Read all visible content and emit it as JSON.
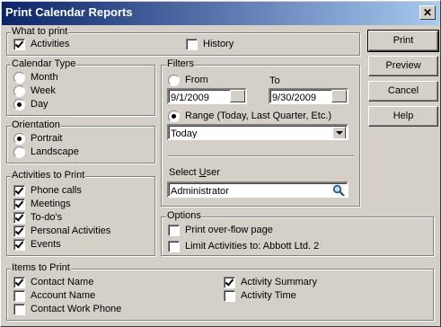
{
  "window": {
    "title": "Print Calendar Reports",
    "close_glyph": "✕"
  },
  "what_to_print": {
    "legend": "What to print",
    "activities": {
      "label": "Activities",
      "checked": true
    },
    "history": {
      "label": "History",
      "checked": false
    }
  },
  "calendar_type": {
    "legend": "Calendar Type",
    "options": [
      {
        "label": "Month",
        "selected": false
      },
      {
        "label": "Week",
        "selected": false
      },
      {
        "label": "Day",
        "selected": true
      }
    ]
  },
  "filters": {
    "legend": "Filters",
    "from_label": "From",
    "to_label": "To",
    "from_value": "9/1/2009",
    "to_value": "9/30/2009",
    "range_label": "Range (Today, Last Quarter, Etc.)",
    "range_value": "Today",
    "select_user_label_pre": "Select ",
    "select_user_label_ul": "U",
    "select_user_label_post": "ser",
    "user_value": "Administrator"
  },
  "orientation": {
    "legend": "Orientation",
    "options": [
      {
        "label": "Portrait",
        "selected": true
      },
      {
        "label": "Landscape",
        "selected": false
      }
    ]
  },
  "activities_to_print": {
    "legend": "Activities to Print",
    "items": [
      {
        "label": "Phone calls",
        "checked": true
      },
      {
        "label": "Meetings",
        "checked": true
      },
      {
        "label": "To-do's",
        "checked": true
      },
      {
        "label": "Personal Activities",
        "checked": true
      },
      {
        "label": "Events",
        "checked": true
      }
    ]
  },
  "options": {
    "legend": "Options",
    "items": [
      {
        "label": "Print over-flow page",
        "checked": false
      },
      {
        "label": "Limit Activities to: Abbott Ltd. 2",
        "checked": false
      }
    ]
  },
  "items_to_print": {
    "legend": "Items to Print",
    "items": [
      {
        "label": "Contact Name",
        "checked": true
      },
      {
        "label": "Account Name",
        "checked": false
      },
      {
        "label": "Contact Work Phone",
        "checked": false
      },
      {
        "label": "Activity Summary",
        "checked": true
      },
      {
        "label": "Activity Time",
        "checked": false
      }
    ]
  },
  "buttons": {
    "print": "Print",
    "preview": "Preview",
    "cancel": "Cancel",
    "help": "Help"
  },
  "icons": {
    "search": "magnifier-icon",
    "dropdown": "chevron-down-icon"
  }
}
